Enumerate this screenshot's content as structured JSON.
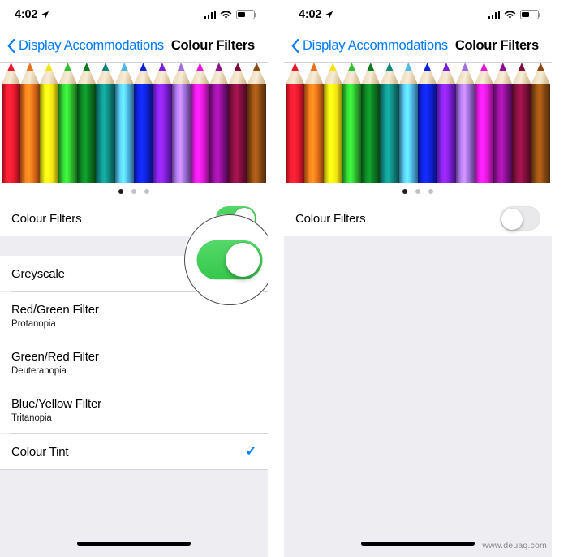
{
  "status_bar": {
    "time": "4:02",
    "location_icon": "location-arrow-icon",
    "signal_icon": "cellular-signal-icon",
    "wifi_icon": "wifi-icon",
    "battery_icon": "battery-icon"
  },
  "nav": {
    "back_icon": "chevron-left-icon",
    "back_label": "Display Accommodations",
    "title": "Colour Filters"
  },
  "banner": {
    "image_name": "coloured-pencils-photo",
    "page_dots": 3,
    "active_dot": 1,
    "pencil_colors": [
      "#e8192c",
      "#e8701a",
      "#f2e510",
      "#2fbf2f",
      "#0c7a22",
      "#0f857e",
      "#4fb6e8",
      "#0f21d8",
      "#7a1fd8",
      "#a070e0",
      "#e019d8",
      "#8a1090",
      "#7d0f3c",
      "#8a4a12"
    ]
  },
  "toggle_row": {
    "label": "Colour Filters",
    "left_state": "on",
    "right_state": "off",
    "on_color": "#35c84b",
    "off_color": "#e9e9eb"
  },
  "filters": [
    {
      "title": "Greyscale",
      "subtitle": "",
      "checked": false
    },
    {
      "title": "Red/Green Filter",
      "subtitle": "Protanopia",
      "checked": false
    },
    {
      "title": "Green/Red Filter",
      "subtitle": "Deuteranopia",
      "checked": false
    },
    {
      "title": "Blue/Yellow Filter",
      "subtitle": "Tritanopia",
      "checked": false
    },
    {
      "title": "Colour Tint",
      "subtitle": "",
      "checked": true
    }
  ],
  "check_glyph": "✓",
  "accent_color": "#007aff",
  "watermark": "www.deuaq.com"
}
